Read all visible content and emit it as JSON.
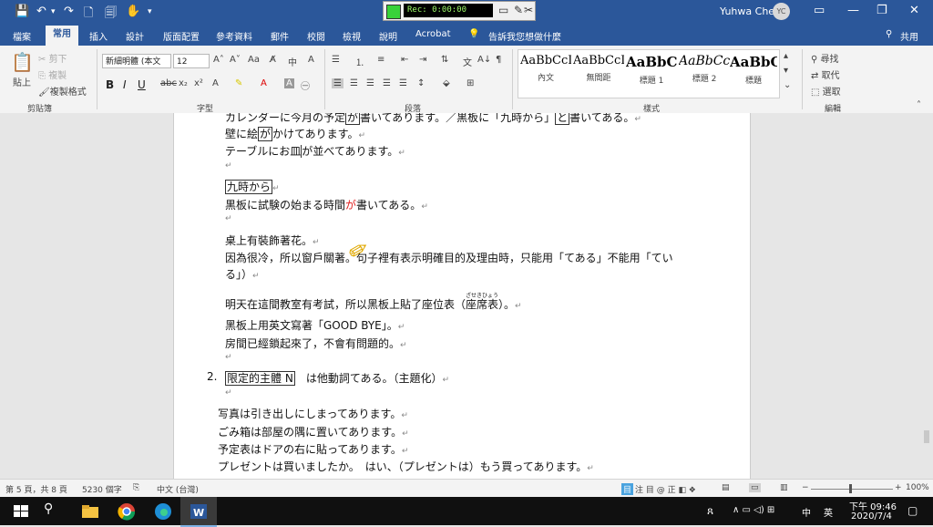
{
  "titlebar": {
    "recorder_time": "Rec: 0:00:00",
    "user_name": "Yuhwa Chen",
    "user_initials": "YC"
  },
  "tabs": [
    "檔案",
    "常用",
    "插入",
    "設計",
    "版面配置",
    "參考資料",
    "郵件",
    "校閱",
    "檢視",
    "說明",
    "Acrobat",
    "告訴我您想做什麼"
  ],
  "share_label": "共用",
  "ribbon": {
    "clipboard": {
      "paste": "貼上",
      "cut": "剪下",
      "copy": "複製",
      "format_painter": "複製格式",
      "label": "剪貼簿"
    },
    "font": {
      "name": "新細明體 (本文",
      "size": "12",
      "aa": "Aa",
      "label": "字型"
    },
    "paragraph": {
      "label": "段落"
    },
    "styles": {
      "label": "樣式",
      "items": [
        {
          "sample": "AaBbCcI",
          "name": "內文"
        },
        {
          "sample": "AaBbCcI",
          "name": "無間距"
        },
        {
          "sample": "AaBbC",
          "name": "標題 1"
        },
        {
          "sample": "AaBbCc",
          "name": "標題 2"
        },
        {
          "sample": "AaBbC",
          "name": "標題"
        }
      ]
    },
    "editing": {
      "find": "尋找",
      "replace": "取代",
      "select": "選取",
      "label": "編輯"
    }
  },
  "document": {
    "lines": [
      {
        "pre": "カレンダーに今月の予定",
        "box": "が",
        "post": "書いてあります。／黒板に「九時から」",
        "box2": "と",
        "post2": "書いてある。"
      },
      {
        "pre": "壁に絵",
        "box": "が",
        "post": "かけてあります。"
      },
      {
        "pre": "テーブルにお皿",
        "box": "が",
        "post": "並べてあります。"
      },
      {
        "boxed_text": "九時から"
      },
      {
        "pre": "黒板に試験の始まる時間",
        "red": "が",
        "post": "書いてある。"
      },
      {
        "text": "桌上有裝飾著花。"
      },
      {
        "pre": "因為很冷，所以窗戶關著。句子裡有表示明確目的及理由時，只能用「てある」不能用「てい"
      },
      {
        "text": "る」）"
      },
      {
        "pre": "明天在這間教室有考試，所以黑板上貼了座位表（",
        "ruby": "ざせきひょう",
        "ruby_base": "座席表",
        "post": "）。"
      },
      {
        "text": "黑板上用英文寫著「GOOD BYE」。"
      },
      {
        "text": "房間已經鎖起來了，不會有問題的。"
      },
      {
        "number": "2.",
        "boxed_text": "限定的主體 N",
        "post": "は他動詞てある。（主題化）"
      },
      {
        "text": "写真は引き出しにしまってあります。"
      },
      {
        "text": "ごみ箱は部屋の隅に置いてあります。"
      },
      {
        "text": "予定表はドアの右に貼ってあります。"
      },
      {
        "text": "プレゼントは買いましたか。　はい、（プレゼントは）もう買ってあります。"
      }
    ]
  },
  "statusbar": {
    "page": "第 5 頁，共 8 頁",
    "words": "5230 個字",
    "lang": "中文 (台灣)",
    "zoom": "100%"
  },
  "taskbar": {
    "time": "下午 09:46",
    "date": "2020/7/4",
    "ime": "中",
    "ime2": "英"
  },
  "colors": {
    "accent": "#2b579a",
    "red_mark": "#e02020"
  }
}
